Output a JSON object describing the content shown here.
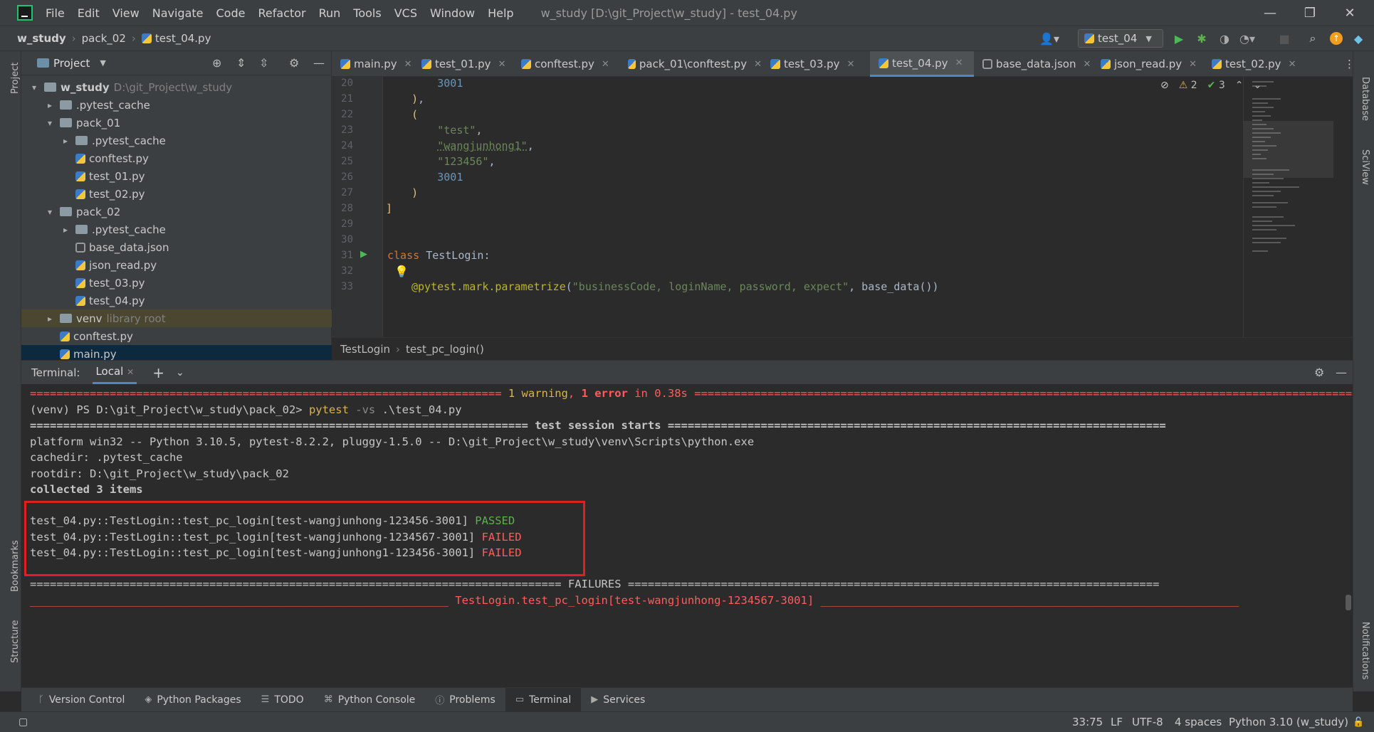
{
  "window": {
    "title": "w_study [D:\\git_Project\\w_study] - test_04.py",
    "menu": [
      "File",
      "Edit",
      "View",
      "Navigate",
      "Code",
      "Refactor",
      "Run",
      "Tools",
      "VCS",
      "Window",
      "Help"
    ]
  },
  "navbar": {
    "crumbs": [
      "w_study",
      "pack_02",
      "test_04.py"
    ],
    "run_config": "test_04"
  },
  "project_panel": {
    "title": "Project",
    "tree": [
      {
        "label": "w_study",
        "extra": "D:\\git_Project\\w_study",
        "type": "folder",
        "arrow": "▾"
      },
      {
        "label": ".pytest_cache",
        "type": "folder",
        "arrow": "▸"
      },
      {
        "label": "pack_01",
        "type": "folder",
        "arrow": "▾"
      },
      {
        "label": ".pytest_cache",
        "type": "folder",
        "arrow": "▸"
      },
      {
        "label": "conftest.py",
        "type": "py"
      },
      {
        "label": "test_01.py",
        "type": "py"
      },
      {
        "label": "test_02.py",
        "type": "py"
      },
      {
        "label": "pack_02",
        "type": "folder",
        "arrow": "▾"
      },
      {
        "label": ".pytest_cache",
        "type": "folder",
        "arrow": "▸"
      },
      {
        "label": "base_data.json",
        "type": "json"
      },
      {
        "label": "json_read.py",
        "type": "py"
      },
      {
        "label": "test_03.py",
        "type": "py"
      },
      {
        "label": "test_04.py",
        "type": "py"
      },
      {
        "label": "venv",
        "extra": "library root",
        "type": "folder",
        "arrow": "▸"
      },
      {
        "label": "conftest.py",
        "type": "py"
      },
      {
        "label": "main.py",
        "type": "py"
      }
    ]
  },
  "editor_tabs": [
    "main.py",
    "test_01.py",
    "conftest.py",
    "pack_01\\conftest.py",
    "test_03.py",
    "test_04.py",
    "base_data.json",
    "json_read.py",
    "test_02.py"
  ],
  "editor": {
    "line_numbers": [
      "20",
      "21",
      "22",
      "23",
      "24",
      "25",
      "26",
      "27",
      "28",
      "29",
      "30",
      "31",
      "32",
      "33"
    ],
    "inspections": {
      "warnings": "2",
      "ok": "3"
    },
    "breadcrumb": [
      "TestLogin",
      "test_pc_login()"
    ]
  },
  "terminal": {
    "label": "Terminal:",
    "tab": "Local",
    "summary_prev": {
      "prefix": "======================================================================= ",
      "warn": "1 warning",
      "sep": ", ",
      "err": "1 error",
      "time": " in 0.38s ",
      "suffix": "======================================================================================================================"
    },
    "prompt": "(venv) PS D:\\git_Project\\w_study\\pack_02> ",
    "cmd": "pytest",
    "flag": " -vs",
    "arg": " .\\test_04.py",
    "session_start": "=========================================================================== test session starts ===========================================================================",
    "platform": "platform win32 -- Python 3.10.5, pytest-8.2.2, pluggy-1.5.0 -- D:\\git_Project\\w_study\\venv\\Scripts\\python.exe",
    "cachedir": "cachedir: .pytest_cache",
    "rootdir": "rootdir: D:\\git_Project\\w_study\\pack_02",
    "collected": "collected 3 items",
    "results": [
      {
        "test": "test_04.py::TestLogin::test_pc_login[test-wangjunhong-123456-3001] ",
        "status": "PASSED"
      },
      {
        "test": "test_04.py::TestLogin::test_pc_login[test-wangjunhong-1234567-3001] ",
        "status": "FAILED"
      },
      {
        "test": "test_04.py::TestLogin::test_pc_login[test-wangjunhong1-123456-3001] ",
        "status": "FAILED"
      }
    ],
    "failures": "================================================================================ FAILURES ================================================================================",
    "failure_head": "_______________________________________________________________ TestLogin.test_pc_login[test-wangjunhong-1234567-3001] _______________________________________________________________"
  },
  "bottom_tools": [
    "Version Control",
    "Python Packages",
    "TODO",
    "Python Console",
    "Problems",
    "Terminal",
    "Services"
  ],
  "statusbar": {
    "position": "33:75",
    "line_sep": "LF",
    "encoding": "UTF-8",
    "indent": "4 spaces",
    "interpreter": "Python 3.10 (w_study)"
  },
  "side_labels": {
    "project": "Project",
    "bookmarks": "Bookmarks",
    "structure": "Structure",
    "database": "Database",
    "sciview": "SciView",
    "notifications": "Notifications"
  },
  "colors": {
    "accent": "#4a88c7",
    "passed": "#5fae4f",
    "failed": "#ff5c5c",
    "highlight": "#e02020"
  }
}
